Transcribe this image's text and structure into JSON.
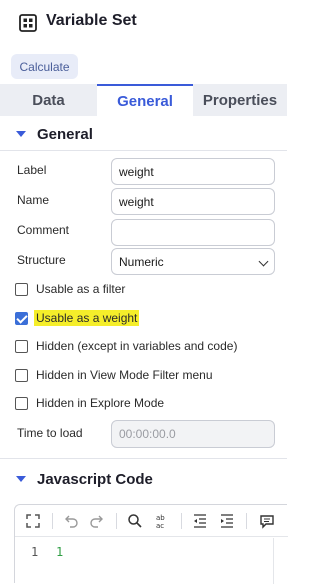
{
  "header": {
    "title": "Variable Set",
    "icon": "grid-icon"
  },
  "toolbar": {
    "calculate_label": "Calculate"
  },
  "tabs": [
    {
      "label": "Data",
      "active": false
    },
    {
      "label": "General",
      "active": true
    },
    {
      "label": "Properties",
      "active": false
    }
  ],
  "general": {
    "section_title": "General",
    "label": {
      "label": "Label",
      "value": "weight"
    },
    "name": {
      "label": "Name",
      "value": "weight"
    },
    "comment": {
      "label": "Comment",
      "value": ""
    },
    "structure": {
      "label": "Structure",
      "value": "Numeric"
    },
    "checkboxes": [
      {
        "label": "Usable as a filter",
        "checked": false
      },
      {
        "label": "Usable as a weight",
        "checked": true,
        "highlighted": true
      },
      {
        "label": "Hidden (except in variables and code)",
        "checked": false
      },
      {
        "label": "Hidden in View Mode Filter menu",
        "checked": false
      },
      {
        "label": "Hidden in Explore Mode",
        "checked": false
      }
    ],
    "time_to_load": {
      "label": "Time to load",
      "value": "00:00:00.0"
    }
  },
  "code": {
    "section_title": "Javascript Code",
    "line_number": "1",
    "line_text": "1"
  },
  "colors": {
    "accent": "#3a5bd9",
    "checkbox": "#3b6fd8",
    "highlight": "#f5ee2a",
    "code_text": "#2f9e44"
  }
}
